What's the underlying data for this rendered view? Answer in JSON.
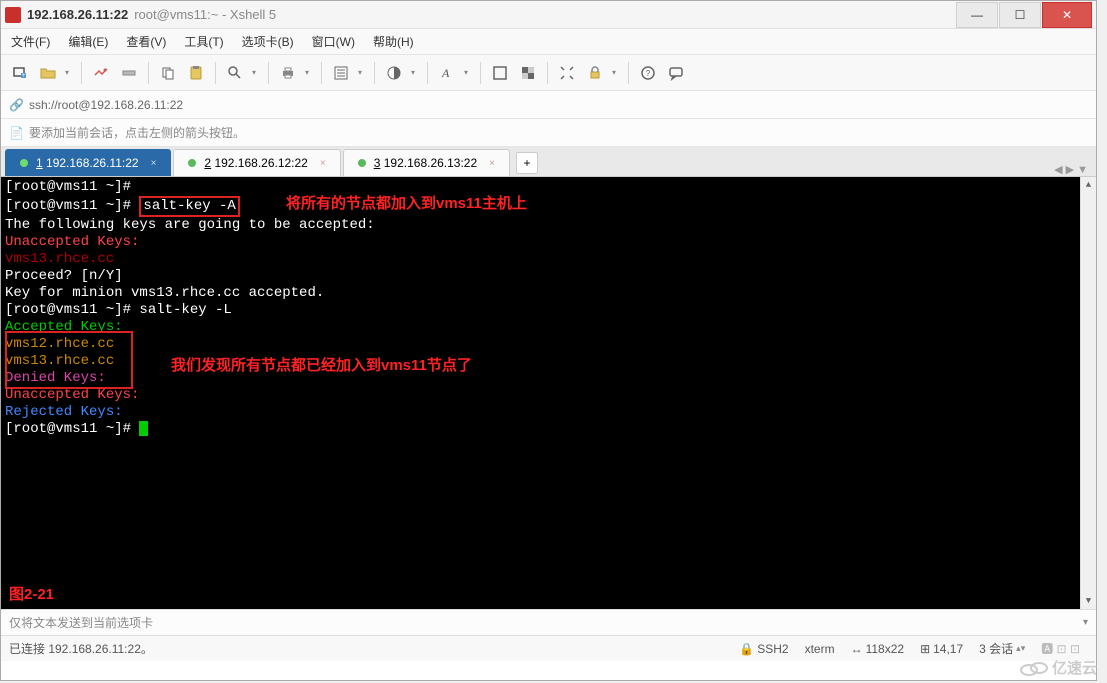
{
  "titlebar": {
    "host": "192.168.26.11:22",
    "subtitle": "root@vms11:~ - Xshell 5"
  },
  "menu": {
    "file": "文件(F)",
    "edit": "编辑(E)",
    "view": "查看(V)",
    "tools": "工具(T)",
    "tab": "选项卡(B)",
    "window": "窗口(W)",
    "help": "帮助(H)"
  },
  "address": {
    "url": "ssh://root@192.168.26.11:22"
  },
  "tip": {
    "text": "要添加当前会话，点击左侧的箭头按钮。"
  },
  "tabs": {
    "items": [
      {
        "num": "1",
        "label": "192.168.26.11:22",
        "active": true
      },
      {
        "num": "2",
        "label": "192.168.26.12:22",
        "active": false
      },
      {
        "num": "3",
        "label": "192.168.26.13:22",
        "active": false
      }
    ],
    "add": "+",
    "nav": "◀ ▶ ▼"
  },
  "terminal": {
    "lines": [
      {
        "t": "prompt",
        "text": "[root@vms11 ~]# "
      },
      {
        "t": "prompt_cmd",
        "prompt": "[root@vms11 ~]# ",
        "cmd": "salt-key -A",
        "box": true
      },
      {
        "t": "plain",
        "text": "The following keys are going to be accepted:"
      },
      {
        "t": "red",
        "text": "Unaccepted Keys:"
      },
      {
        "t": "darkred",
        "text": "vms13.rhce.cc"
      },
      {
        "t": "plain",
        "text": "Proceed? [n/Y] "
      },
      {
        "t": "plain",
        "text": "Key for minion vms13.rhce.cc accepted."
      },
      {
        "t": "prompt_cmd",
        "prompt": "[root@vms11 ~]# ",
        "cmd": "salt-key -L"
      },
      {
        "t": "green",
        "text": "Accepted Keys:"
      },
      {
        "t": "orange",
        "text": "vms12.rhce.cc"
      },
      {
        "t": "orange",
        "text": "vms13.rhce.cc"
      },
      {
        "t": "magenta",
        "text": "Denied Keys:"
      },
      {
        "t": "red",
        "text": "Unaccepted Keys:"
      },
      {
        "t": "blue",
        "text": "Rejected Keys:"
      },
      {
        "t": "prompt_cursor",
        "prompt": "[root@vms11 ~]# "
      }
    ],
    "annotations": {
      "a1": "将所有的节点都加入到vms11主机上",
      "a2": "我们发现所有节点都已经加入到vms11节点了",
      "caption": "图2-21"
    }
  },
  "inputbar": {
    "placeholder": "仅将文本发送到当前选项卡"
  },
  "statusbar": {
    "conn": "已连接 192.168.26.11:22。",
    "ssh": "SSH2",
    "term": "xterm",
    "size": "118x22",
    "pos": "14,17",
    "sessions": "3 会话"
  },
  "watermark": "亿速云"
}
